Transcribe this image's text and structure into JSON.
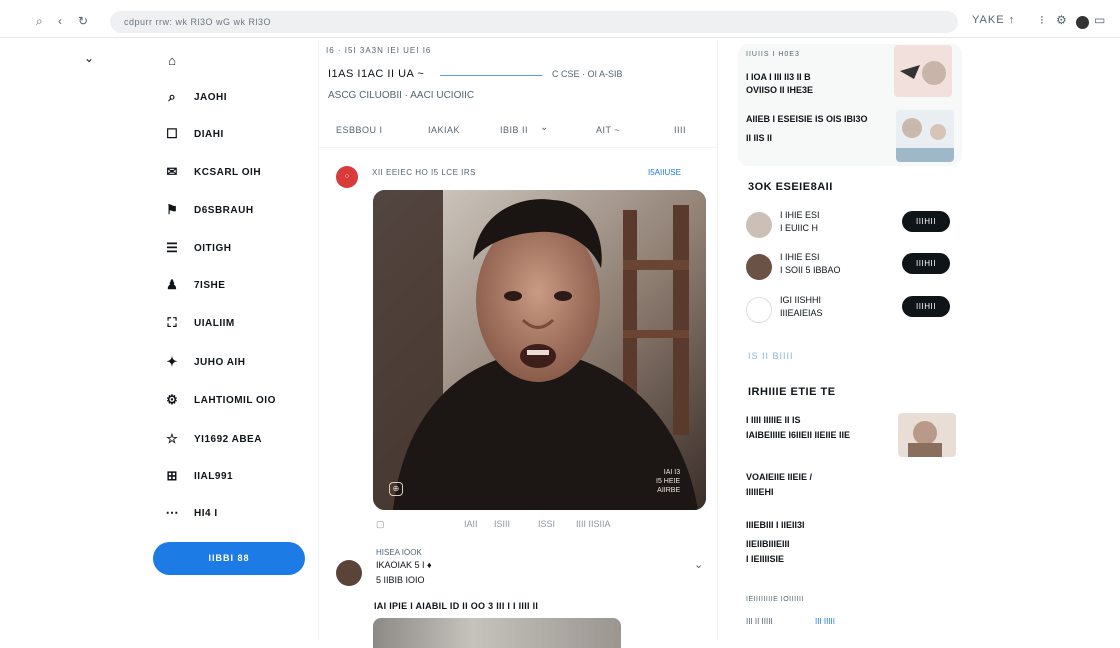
{
  "browser": {
    "url": "cdpurr rrw: wk Rl3O wG wk Rl3O",
    "right_text": "YAKE ↑",
    "nav_icons": [
      "search-icon",
      "back-icon",
      "reload-icon"
    ]
  },
  "sidebar": {
    "items": [
      {
        "icon": "⌂",
        "label": ""
      },
      {
        "icon": "⌕",
        "label": "JAOHI"
      },
      {
        "icon": "☐",
        "label": "DIAHI"
      },
      {
        "icon": "✉",
        "label": "KCSARL OIH"
      },
      {
        "icon": "⚑",
        "label": "D6SBRAUH"
      },
      {
        "icon": "☰",
        "label": "OITIGH"
      },
      {
        "icon": "♟",
        "label": "7ISHE"
      },
      {
        "icon": "⛶",
        "label": "UIALIIM"
      },
      {
        "icon": "✦",
        "label": "JUHO AIH"
      },
      {
        "icon": "⚙",
        "label": "LAHTIOMIL OIO"
      },
      {
        "icon": "☆",
        "label": "YI1692 ABEA"
      },
      {
        "icon": "⊞",
        "label": "IIAL991"
      },
      {
        "icon": "⋯",
        "label": "HI4 I"
      }
    ],
    "post_label": "IIBBI 88"
  },
  "feed": {
    "crumb": "I6 · I5I 3A3N IEI UEI I6",
    "title": "I1AS I1AC II UA ~",
    "meta": "C CSE · OI A-SIB",
    "sub": "ASCG CILUOBII · AACI UCIOIIC",
    "tabs": [
      "ESBBOU I",
      "IAKIAK",
      "IBIB II",
      "AIT ~",
      "IIII"
    ],
    "post1": {
      "avatar": "○",
      "header": "XII  EEIEC HO I5 LCE IRS",
      "header_right": "I5AIIUSE",
      "caption": "IAI I3\nI5 HEIE\nAIIRBE",
      "actions": [
        "IAII",
        "ISIII",
        "ISSI",
        "IIII IISIIA"
      ]
    },
    "post2": {
      "name": "HISEA IOOK",
      "line1": "IKAOIAK 5 I ♦",
      "line2": "5 IIBIB IOIO",
      "text": "IAI IPIE I AIABIL ID II OO 3 III I I IIII II"
    }
  },
  "right": {
    "trend_title": "IIUIIS I H0E3",
    "trend_lines": [
      "I IOA I III II3 II B",
      "OVIISO II IHE3E",
      "AIIEB I ESEISIE IS OIS IBI3O",
      "II IIS II"
    ],
    "follow_header": "3OK ESEIE8AII",
    "follow": [
      {
        "name": "I IHIE ESI",
        "handle": "I EUIIC H",
        "btn": "IIIHII"
      },
      {
        "name": "I IHIE ESI",
        "handle": "I SOII 5 IBBAO",
        "btn": "IIIHII"
      },
      {
        "name": "IGI IISHHI",
        "handle": "IIIEAIEIAS",
        "btn": "IIIHII"
      }
    ],
    "show_more": "IS II BIIII",
    "section2_header": "IRHIIIE ETIE TE",
    "section2_lines": [
      "I IIII IIIIIE II IS",
      "IAIBEIIIIE I6IIEII IIEIIE IIE"
    ],
    "more_lines": [
      "VOAIEIIE IIEIE /",
      "IIIIIEHI",
      "IIIEBIII I IIEII3I",
      "IIEIIBIIIEIII",
      "I IEIIIISIE"
    ],
    "footer": "IEIIIIIIIIE IOIIIIII",
    "footer2": "III II IIIII",
    "footer2_right": "III IIIII"
  }
}
